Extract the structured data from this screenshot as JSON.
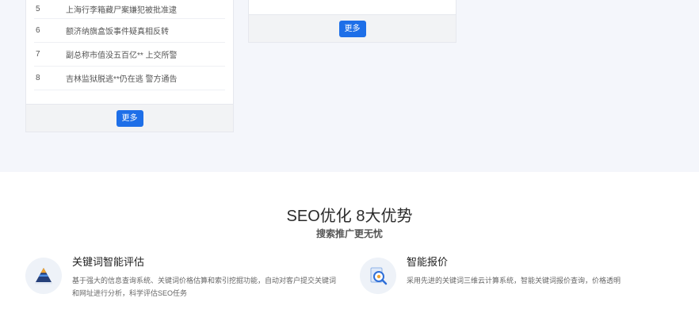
{
  "news_card": {
    "items": [
      {
        "num": "5",
        "title": "上海行李箱藏尸案嫌犯被批准逮"
      },
      {
        "num": "6",
        "title": "额济纳旗盒饭事件疑真相反转"
      },
      {
        "num": "7",
        "title": "副总称市值没五百亿** 上交所警"
      },
      {
        "num": "8",
        "title": "吉林监狱脱逃**仍在逃 警方通告"
      }
    ],
    "more_label": "更多"
  },
  "side_card": {
    "more_label": "更多"
  },
  "advantages": {
    "title": "SEO优化 8大优势",
    "subtitle": "搜索推广更无忧",
    "features": [
      {
        "title": "关键词智能评估",
        "desc": "基于强大的信息查询系统、关键词价格估算和索引挖掘功能，自动对客户提交关键词和网址进行分析，科学评估SEO任务",
        "icon": "pyramid-icon"
      },
      {
        "title": "智能报价",
        "desc": "采用先进的关键词三维云计算系统，智能关键词报价查询，价格透明",
        "icon": "magnifier-icon"
      }
    ]
  },
  "colors": {
    "accent": "#1e6fe8",
    "band_background": "#f4f6fb"
  }
}
